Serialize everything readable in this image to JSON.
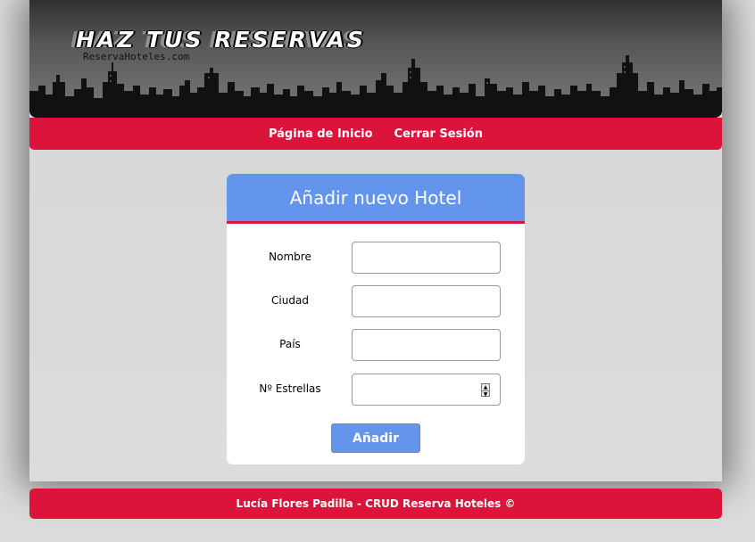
{
  "header": {
    "title": "HAZ TUS RESERVAS",
    "subtitle": "ReservaHoteles.com"
  },
  "nav": {
    "items": [
      {
        "label": "Página de Inicio"
      },
      {
        "label": "Cerrar Sesión"
      }
    ]
  },
  "form": {
    "title": "Añadir nuevo Hotel",
    "fields": [
      {
        "label": "Nombre",
        "value": ""
      },
      {
        "label": "Ciudad",
        "value": ""
      },
      {
        "label": "País",
        "value": ""
      },
      {
        "label": "Nº Estrellas",
        "value": ""
      }
    ],
    "submit_label": "Añadir"
  },
  "footer": {
    "text": "Lucía Flores Padilla - CRUD Reserva Hoteles ©"
  },
  "colors": {
    "accent": "#dc143c",
    "primary": "#6495ed",
    "background": "#dcdcdc"
  }
}
